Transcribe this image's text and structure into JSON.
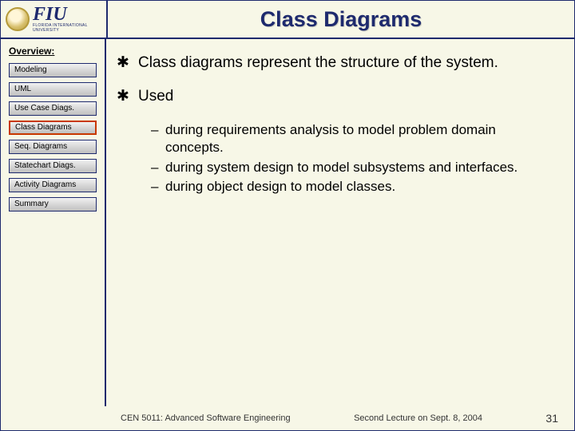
{
  "header": {
    "logo_main": "FIU",
    "logo_sub": "FLORIDA INTERNATIONAL UNIVERSITY",
    "title": "Class Diagrams"
  },
  "sidebar": {
    "heading": "Overview:",
    "items": [
      {
        "label": "Modeling",
        "active": false
      },
      {
        "label": "UML",
        "active": false
      },
      {
        "label": "Use Case Diags.",
        "active": false
      },
      {
        "label": "Class Diagrams",
        "active": true
      },
      {
        "label": "Seq. Diagrams",
        "active": false
      },
      {
        "label": "Statechart Diags.",
        "active": false
      },
      {
        "label": "Activity Diagrams",
        "active": false
      },
      {
        "label": "Summary",
        "active": false
      }
    ]
  },
  "content": {
    "bullets": [
      {
        "text": "Class diagrams represent the structure of the system."
      },
      {
        "text": "Used",
        "subitems": [
          "during requirements analysis to model problem domain concepts.",
          "during system design to model subsystems and interfaces.",
          "during object design to model classes."
        ]
      }
    ]
  },
  "footer": {
    "course": "CEN 5011: Advanced Software Engineering",
    "lecture": "Second Lecture on Sept. 8, 2004",
    "page": "31"
  }
}
